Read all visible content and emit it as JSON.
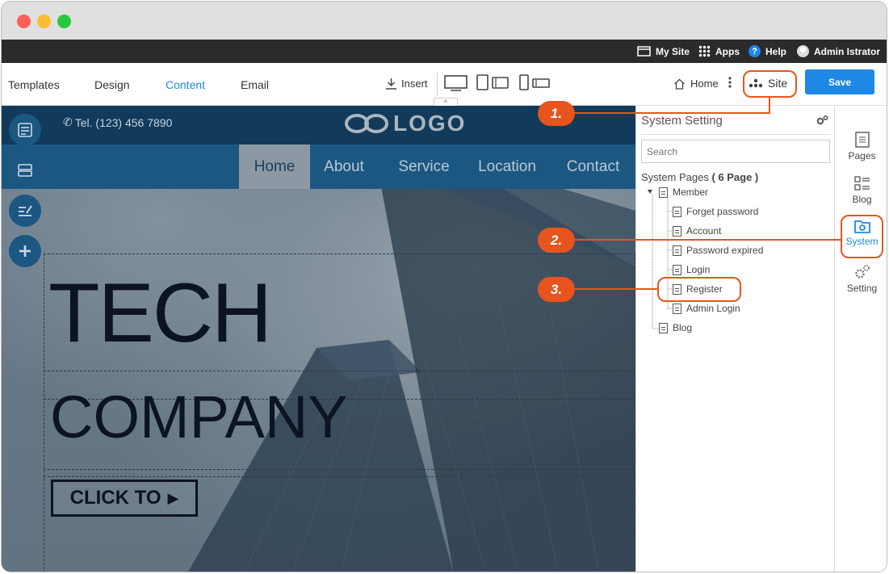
{
  "topbar": {
    "my_site": "My Site",
    "apps": "Apps",
    "help": "Help",
    "user": "Admin Istrator"
  },
  "toolbar": {
    "tabs": [
      "Templates",
      "Design",
      "Content",
      "Email"
    ],
    "active_tab": "Content",
    "insert": "Insert",
    "home": "Home",
    "site": "Site",
    "save": "Save"
  },
  "site_preview": {
    "phone": "Tel. (123) 456 7890",
    "logo": "LOGO",
    "nav": [
      "Home",
      "About",
      "Service",
      "Location",
      "Contact"
    ],
    "nav_active": "Home",
    "hero_line1": "TECH",
    "hero_line2": "COMPANY",
    "cta": "CLICK TO"
  },
  "panel": {
    "title": "System Setting",
    "search_placeholder": "Search",
    "section_label": "System Pages",
    "section_count": "( 6 Page )",
    "tree": {
      "member": "Member",
      "member_children": [
        "Forget password",
        "Account",
        "Password expired",
        "Login",
        "Register",
        "Admin Login"
      ],
      "blog": "Blog"
    }
  },
  "rail": {
    "pages": "Pages",
    "blog": "Blog",
    "system": "System",
    "setting": "Setting"
  },
  "callouts": [
    "1.",
    "2.",
    "3."
  ],
  "colors": {
    "accent": "#1e88e5",
    "callout": "#e8541d",
    "topbar": "#2b2b2b",
    "site_header": "#123a5a",
    "site_nav": "#1b5781"
  }
}
